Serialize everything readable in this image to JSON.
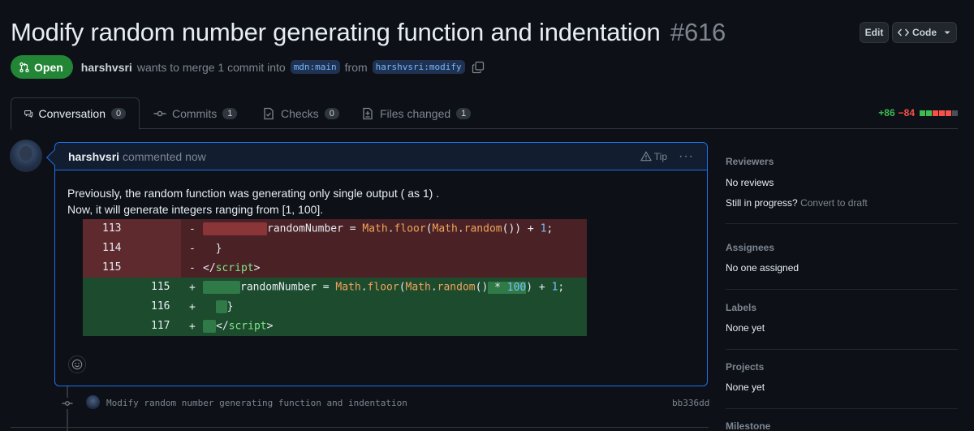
{
  "pr": {
    "title": "Modify random number generating function and indentation",
    "number": "#616",
    "state_label": "Open",
    "author": "harshvsri",
    "merge_text": "wants to merge 1 commit into",
    "base_branch": "mdn:main",
    "from_text": "from",
    "head_branch": "harshvsri:modify"
  },
  "header_buttons": {
    "edit_label": "Edit",
    "code_label": "Code"
  },
  "tabs": [
    {
      "label": "Conversation",
      "count": "0",
      "icon": "comment-icon",
      "active": true
    },
    {
      "label": "Commits",
      "count": "1",
      "icon": "commit-icon"
    },
    {
      "label": "Checks",
      "count": "0",
      "icon": "checklist-icon"
    },
    {
      "label": "Files changed",
      "count": "1",
      "icon": "file-diff-icon"
    }
  ],
  "diffstat": {
    "additions": "+86",
    "deletions": "−84",
    "blocks": [
      "#3fb950",
      "#3fb950",
      "#f85149",
      "#f85149",
      "#f85149",
      "#484f58"
    ]
  },
  "comment": {
    "author": "harshvsri",
    "action": "commented now",
    "tip_label": "Tip",
    "line1": "Previously, the random function was generating only single output ( as 1) .",
    "line2": "Now, it will generate integers ranging from [1, 100].",
    "diff": {
      "deleted": [
        {
          "line": "113",
          "sign": "-"
        },
        {
          "line": "114",
          "sign": "-",
          "text": "}"
        },
        {
          "line": "115",
          "sign": "-"
        }
      ],
      "inserted": [
        {
          "line": "115",
          "sign": "+"
        },
        {
          "line": "116",
          "sign": "+",
          "text": "}"
        },
        {
          "line": "117",
          "sign": "+"
        }
      ],
      "tokens": {
        "var": "randomNumber",
        "eq": " = ",
        "math": "Math",
        "dot": ".",
        "floor": "floor",
        "random": "random",
        "plus": " + ",
        "one": "1",
        "semi": ";",
        "times": " * ",
        "hundred": "100",
        "close_tag": "</",
        "script": "script",
        "gt": ">"
      }
    }
  },
  "commit": {
    "message": "Modify random number generating function and indentation",
    "sha": "bb336dd"
  },
  "sidebar": {
    "reviewers_h": "Reviewers",
    "reviewers_v": "No reviews",
    "progress_q": "Still in progress?",
    "progress_link": "Convert to draft",
    "assignees_h": "Assignees",
    "assignees_v": "No one assigned",
    "labels_h": "Labels",
    "labels_v": "None yet",
    "projects_h": "Projects",
    "projects_v": "None yet",
    "milestone_h": "Milestone"
  }
}
